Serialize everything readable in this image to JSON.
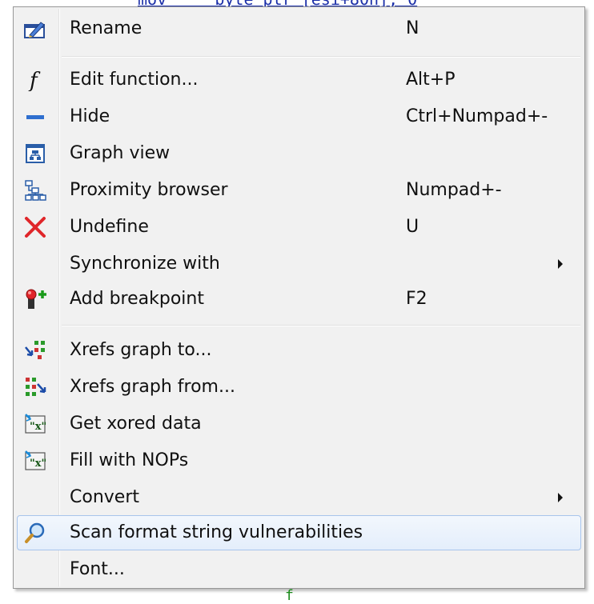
{
  "backdrop": {
    "top_text": "mov     byte ptr [esi+80h], 0",
    "bottom_text": "f"
  },
  "menu": {
    "items": [
      {
        "label": "Rename",
        "shortcut": "N",
        "icon": "rename-icon"
      },
      {
        "label": "Edit function...",
        "shortcut": "Alt+P",
        "icon": "function-icon"
      },
      {
        "label": "Hide",
        "shortcut": "Ctrl+Numpad+-",
        "icon": "hide-icon"
      },
      {
        "label": "Graph view",
        "shortcut": "",
        "icon": "graph-view-icon"
      },
      {
        "label": "Proximity browser",
        "shortcut": "Numpad+-",
        "icon": "proximity-browser-icon"
      },
      {
        "label": "Undefine",
        "shortcut": "U",
        "icon": "undefine-icon"
      },
      {
        "label": "Synchronize with",
        "shortcut": "",
        "icon": "",
        "submenu": true
      },
      {
        "label": "Add breakpoint",
        "shortcut": "F2",
        "icon": "breakpoint-icon"
      },
      {
        "label": "Xrefs graph to...",
        "shortcut": "",
        "icon": "xrefs-to-icon"
      },
      {
        "label": "Xrefs graph from...",
        "shortcut": "",
        "icon": "xrefs-from-icon"
      },
      {
        "label": "Get xored data",
        "shortcut": "",
        "icon": "xored-data-icon"
      },
      {
        "label": "Fill with NOPs",
        "shortcut": "",
        "icon": "fill-nops-icon"
      },
      {
        "label": "Convert",
        "shortcut": "",
        "icon": "",
        "submenu": true
      },
      {
        "label": "Scan format string vulnerabilities",
        "shortcut": "",
        "icon": "magnifier-icon",
        "highlighted": true
      },
      {
        "label": "Font...",
        "shortcut": "",
        "icon": ""
      }
    ]
  },
  "colors": {
    "menu_background": "#f1f1f1",
    "highlight_border": "#a7c4ec",
    "undefine_red": "#e0262a",
    "hide_blue": "#2f6fcf"
  }
}
